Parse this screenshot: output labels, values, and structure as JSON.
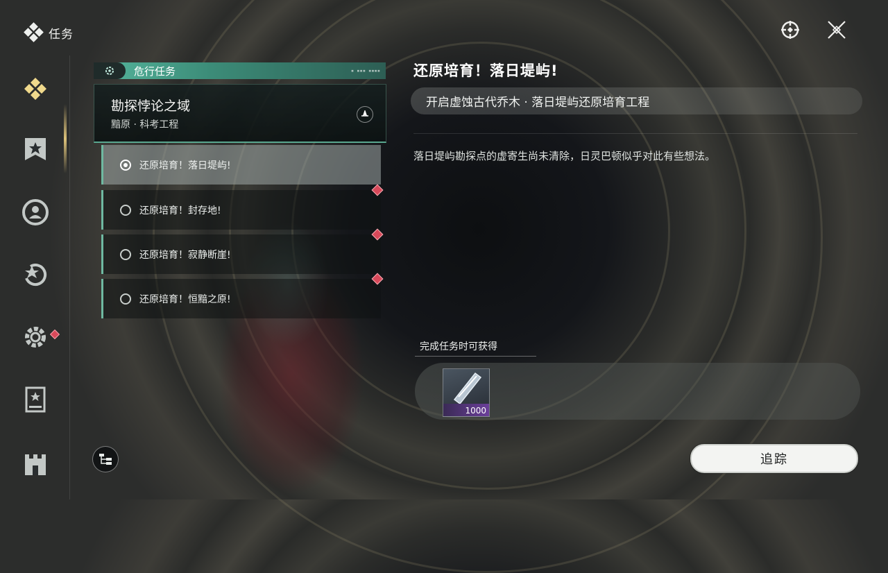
{
  "window": {
    "title": "任务"
  },
  "sidebar": {
    "items": [
      {
        "name": "quest-main",
        "icon": "diamond-cluster-icon",
        "active": true
      },
      {
        "name": "quest-banner",
        "icon": "banner-star-icon",
        "active": false
      },
      {
        "name": "quest-companion",
        "icon": "person-circle-icon",
        "active": false
      },
      {
        "name": "quest-daily",
        "icon": "star-refresh-icon",
        "active": false
      },
      {
        "name": "quest-settings",
        "icon": "gear-icon",
        "active": false,
        "notification": true
      },
      {
        "name": "quest-journal",
        "icon": "book-star-icon",
        "active": false
      },
      {
        "name": "quest-castle",
        "icon": "castle-icon",
        "active": false
      }
    ]
  },
  "quest_list": {
    "category_label": "危行任务",
    "quest_title": "勘探悖论之域",
    "quest_subtitle": "黯原 · 科考工程",
    "sub_quests": [
      {
        "label": "还原培育！落日堤屿!",
        "selected": true,
        "notification": false
      },
      {
        "label": "还原培育！封存地!",
        "selected": false,
        "notification": true
      },
      {
        "label": "还原培育！寂静断崖!",
        "selected": false,
        "notification": true
      },
      {
        "label": "还原培育！恒黯之原!",
        "selected": false,
        "notification": true
      }
    ]
  },
  "detail": {
    "title": "还原培育！落日堤屿!",
    "goal": "开启虚蚀古代乔木 · 落日堤屿还原培育工程",
    "description": "落日堤屿勘探点的虚寄生尚未清除，日灵巴顿似乎对此有些想法。",
    "reward_label": "完成任务时可获得",
    "rewards": [
      {
        "icon": "crystal-tube-icon",
        "count": "1000"
      }
    ],
    "track_button": "追踪"
  },
  "top_right": {
    "icons": [
      "target-crosshair-icon",
      "close-icon"
    ]
  },
  "colors": {
    "accent": "#55b69d",
    "notification": "#d8495a",
    "track_bg": "#f3f4f2"
  }
}
